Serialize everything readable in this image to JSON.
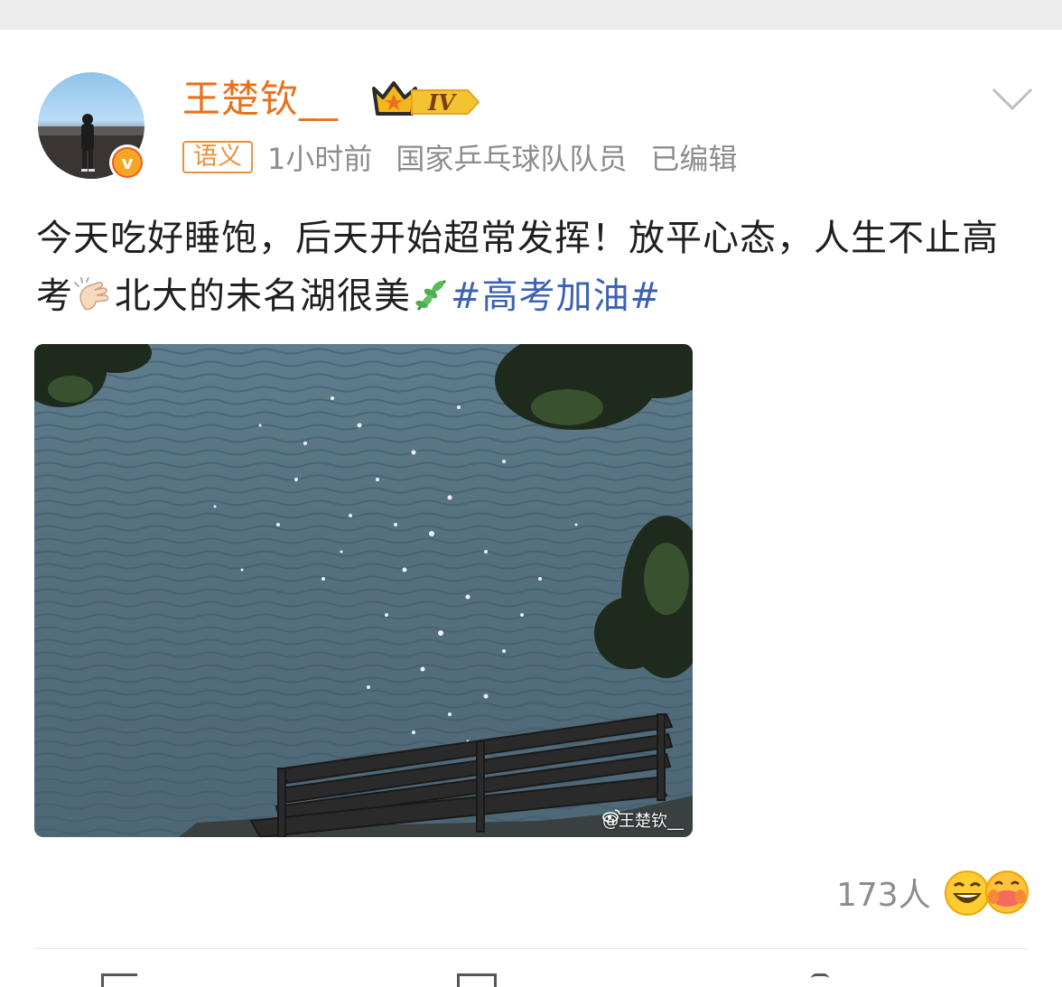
{
  "post": {
    "author": {
      "name": "王楚钦__",
      "level_badge": "IV",
      "verified": true
    },
    "meta": {
      "tag": "语义",
      "time": "1小时前",
      "title": "国家乒乓球队队员",
      "edited": "已编辑"
    },
    "text_part1": "今天吃好睡饱，后天开始超常发挥！放平心态，人生不止高考",
    "text_part2": "北大的未名湖很美",
    "hashtag": "#高考加油#",
    "image_watermark": "@王楚钦__",
    "likes_count": "173人"
  },
  "colors": {
    "username": "#e8711e",
    "hashtag": "#3c62b2",
    "tag_border": "#e9913e",
    "meta_text": "#8c8c8c"
  },
  "icons": [
    "crown-icon",
    "chevron-down-icon",
    "clap-emoji-icon",
    "herb-emoji-icon",
    "laugh-emoji-icon",
    "hug-emoji-icon",
    "weibo-logo-icon"
  ]
}
